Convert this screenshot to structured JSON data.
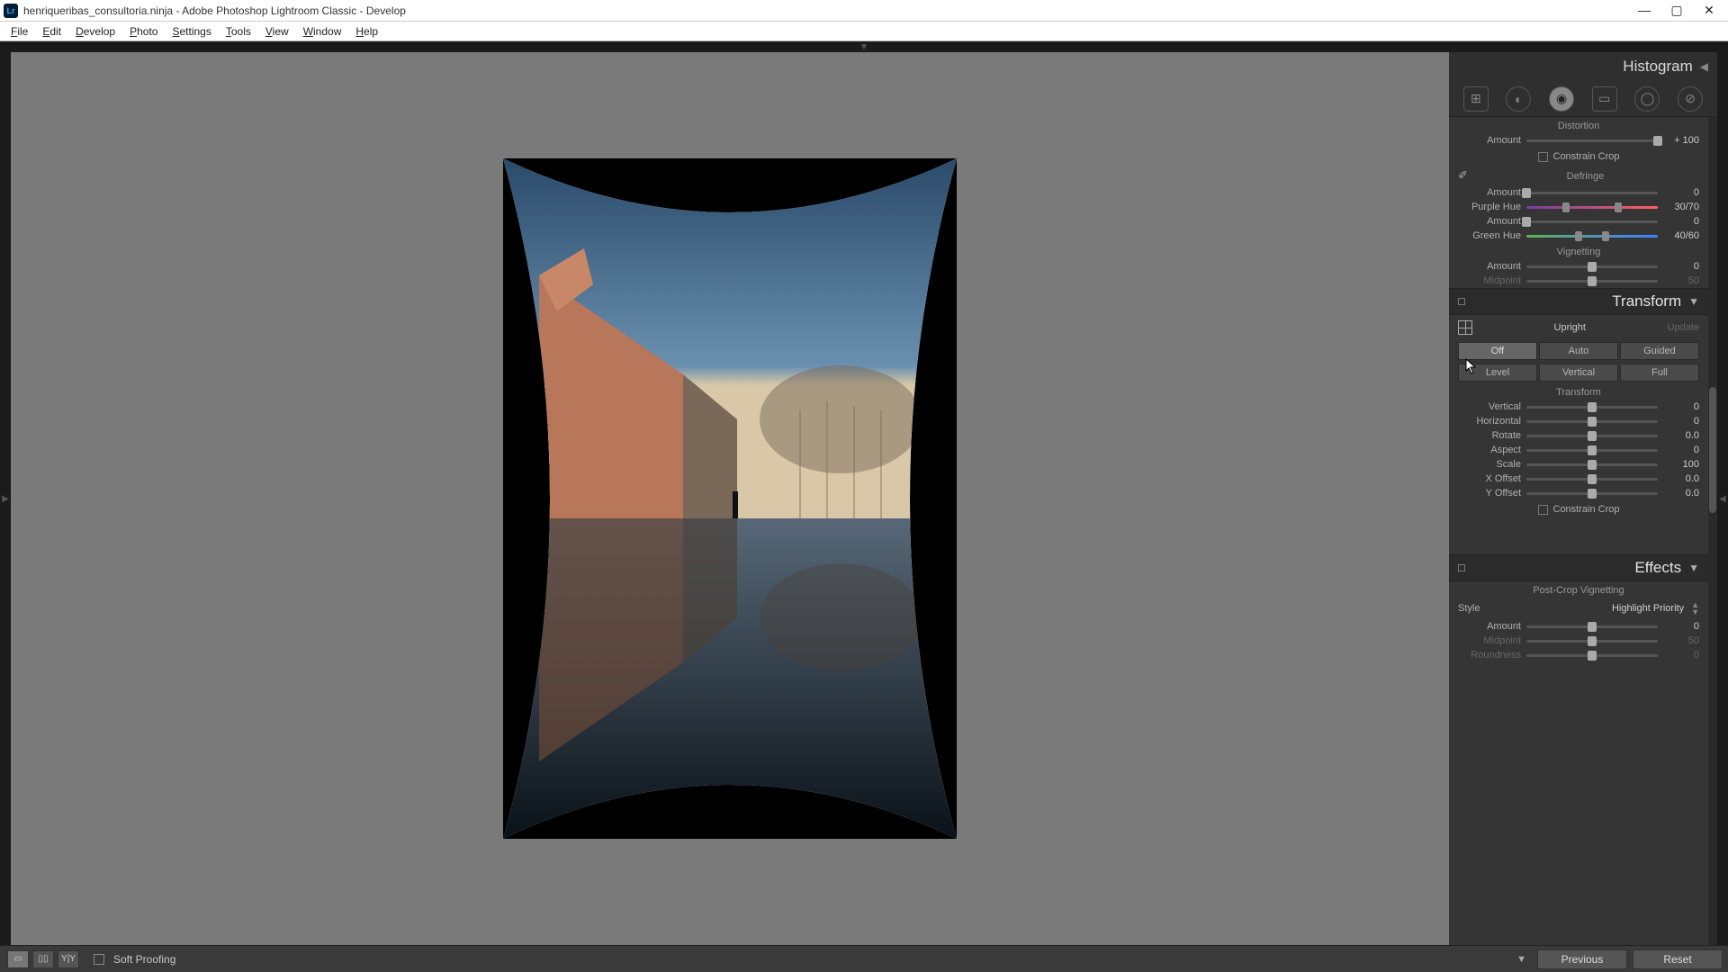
{
  "titlebar": {
    "icon_text": "Lr",
    "title": "henriqueribas_consultoria.ninja - Adobe Photoshop Lightroom Classic - Develop"
  },
  "menu": [
    "File",
    "Edit",
    "Develop",
    "Photo",
    "Settings",
    "Tools",
    "View",
    "Window",
    "Help"
  ],
  "histogram": {
    "title": "Histogram"
  },
  "lens": {
    "distortion_title": "Distortion",
    "amount_lbl": "Amount",
    "amount_val": "+ 100",
    "constrain": "Constrain Crop"
  },
  "defringe": {
    "title": "Defringe",
    "amount1_lbl": "Amount",
    "amount1_val": "0",
    "purple_lbl": "Purple Hue",
    "purple_val": "30/70",
    "amount2_lbl": "Amount",
    "amount2_val": "0",
    "green_lbl": "Green Hue",
    "green_val": "40/60"
  },
  "vignetting": {
    "title": "Vignetting",
    "amount_lbl": "Amount",
    "amount_val": "0",
    "midpoint_lbl": "Midpoint",
    "midpoint_val": "50"
  },
  "transform": {
    "title": "Transform",
    "upright_lbl": "Upright",
    "update_lbl": "Update",
    "buttons": [
      "Off",
      "Auto",
      "Guided",
      "Level",
      "Vertical",
      "Full"
    ],
    "section_lbl": "Transform",
    "sliders": [
      {
        "lbl": "Vertical",
        "val": "0",
        "pos": 50
      },
      {
        "lbl": "Horizontal",
        "val": "0",
        "pos": 50
      },
      {
        "lbl": "Rotate",
        "val": "0.0",
        "pos": 50
      },
      {
        "lbl": "Aspect",
        "val": "0",
        "pos": 50
      },
      {
        "lbl": "Scale",
        "val": "100",
        "pos": 50
      },
      {
        "lbl": "X Offset",
        "val": "0.0",
        "pos": 50
      },
      {
        "lbl": "Y Offset",
        "val": "0.0",
        "pos": 50
      }
    ],
    "constrain": "Constrain Crop"
  },
  "effects": {
    "title": "Effects",
    "pcv_title": "Post-Crop Vignetting",
    "style_lbl": "Style",
    "style_val": "Highlight Priority",
    "amount_lbl": "Amount",
    "amount_val": "0",
    "midpoint_lbl": "Midpoint",
    "midpoint_val": "50",
    "roundness_lbl": "Roundness",
    "roundness_val": "0"
  },
  "bottombar": {
    "soft_proof": "Soft Proofing",
    "previous": "Previous",
    "reset": "Reset"
  }
}
